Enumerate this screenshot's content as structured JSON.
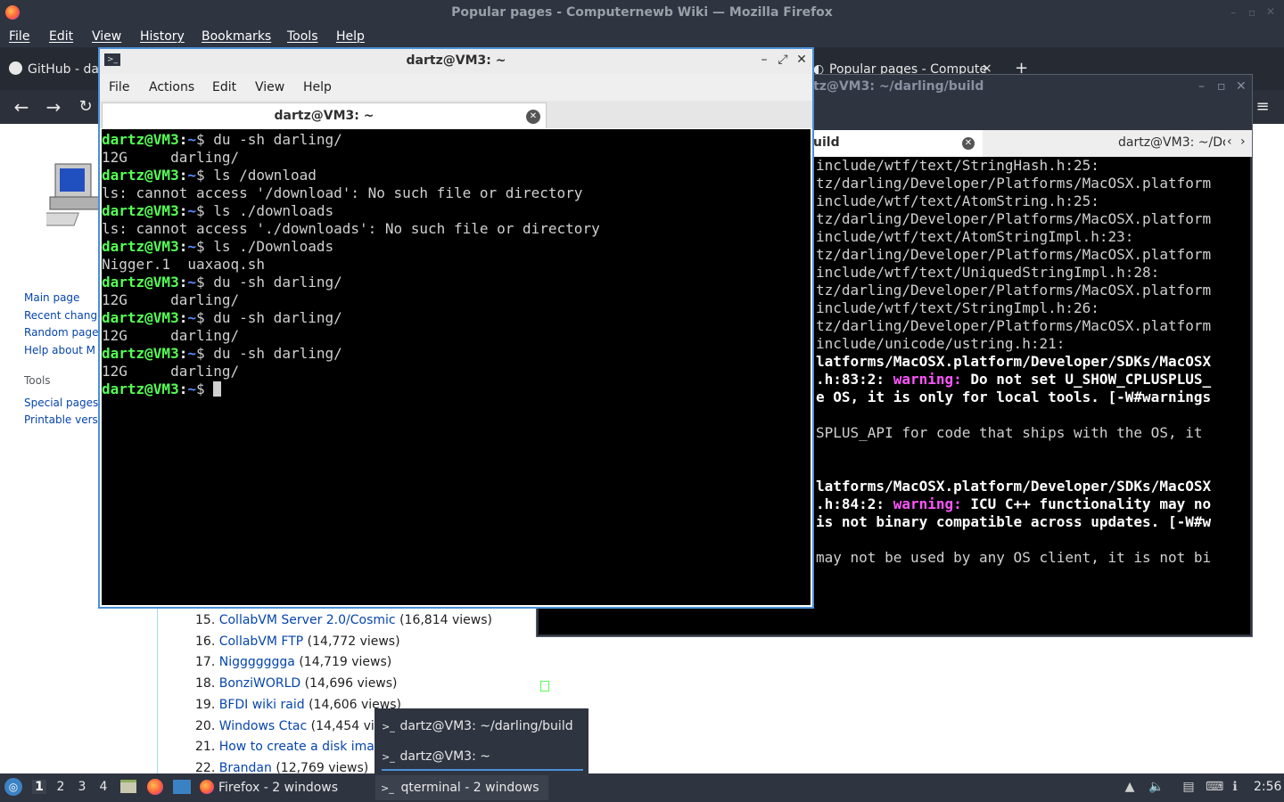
{
  "firefox": {
    "window_title": "Popular pages - Computernewb Wiki — Mozilla Firefox",
    "menu": [
      "File",
      "Edit",
      "View",
      "History",
      "Bookmarks",
      "Tools",
      "Help"
    ],
    "tabs": [
      {
        "label": "GitHub - dar",
        "icon": "github-icon"
      },
      {
        "label": "Popular pages - Compute",
        "icon": "wiki-icon"
      }
    ],
    "new_tab_label": "+"
  },
  "wiki": {
    "sidebar_nav": [
      "Main page",
      "Recent chang",
      "Random page",
      "Help about M"
    ],
    "tools_heading": "Tools",
    "tools": [
      "Special pages",
      "Printable vers"
    ],
    "ranks": [
      {
        "num": "15.",
        "title": "CollabVM Server 2.0/Cosmic",
        "views": "(16,814 views)"
      },
      {
        "num": "16.",
        "title": "CollabVM FTP",
        "views": "(14,772 views)"
      },
      {
        "num": "17.",
        "title": "Niggggggga",
        "views": "(14,719 views)"
      },
      {
        "num": "18.",
        "title": "BonziWORLD",
        "views": "(14,696 views)"
      },
      {
        "num": "19.",
        "title": "BFDI wiki raid",
        "views": "(14,606 views)"
      },
      {
        "num": "20.",
        "title": "Windows Ctac",
        "views": "(14,454 vi"
      },
      {
        "num": "21.",
        "title": "How to create a disk ima",
        "views": ""
      },
      {
        "num": "22.",
        "title": "Brandan",
        "views": "(12,769 views)"
      }
    ]
  },
  "term_back": {
    "title": "tz@VM3: ~/darling/build",
    "tab_active": "uild",
    "tab_other": "dartz@VM3: ~/Dc",
    "lines": [
      {
        "parts": [
          {
            "t": "include/wtf/text/StringHash.h:25:",
            "c": ""
          }
        ]
      },
      {
        "parts": [
          {
            "t": "tz/darling/Developer/Platforms/MacOSX.platform",
            "c": ""
          }
        ]
      },
      {
        "parts": [
          {
            "t": "include/wtf/text/AtomString.h:25:",
            "c": ""
          }
        ]
      },
      {
        "parts": [
          {
            "t": "tz/darling/Developer/Platforms/MacOSX.platform",
            "c": ""
          }
        ]
      },
      {
        "parts": [
          {
            "t": "include/wtf/text/AtomStringImpl.h:23:",
            "c": ""
          }
        ]
      },
      {
        "parts": [
          {
            "t": "tz/darling/Developer/Platforms/MacOSX.platform",
            "c": ""
          }
        ]
      },
      {
        "parts": [
          {
            "t": "include/wtf/text/UniquedStringImpl.h:28:",
            "c": ""
          }
        ]
      },
      {
        "parts": [
          {
            "t": "tz/darling/Developer/Platforms/MacOSX.platform",
            "c": ""
          }
        ]
      },
      {
        "parts": [
          {
            "t": "include/wtf/text/StringImpl.h:26:",
            "c": ""
          }
        ]
      },
      {
        "parts": [
          {
            "t": "tz/darling/Developer/Platforms/MacOSX.platform",
            "c": ""
          }
        ]
      },
      {
        "parts": [
          {
            "t": "include/unicode/ustring.h:21:",
            "c": ""
          }
        ]
      },
      {
        "parts": [
          {
            "t": "latforms/MacOSX.platform/Developer/SDKs/MacOSX",
            "c": "wb"
          }
        ]
      },
      {
        "parts": [
          {
            "t": ".h:83:2: ",
            "c": "wb"
          },
          {
            "t": "warning:",
            "c": "mg"
          },
          {
            "t": " Do not set U_SHOW_CPLUSPLUS_",
            "c": "wb"
          }
        ]
      },
      {
        "parts": [
          {
            "t": "e OS, it is only for local tools. [-W#warnings",
            "c": "wb"
          }
        ]
      },
      {
        "parts": [
          {
            "t": "",
            "c": ""
          }
        ]
      },
      {
        "parts": [
          {
            "t": "SPLUS_API for code that ships with the OS, it",
            "c": ""
          }
        ]
      },
      {
        "parts": [
          {
            "t": "",
            "c": ""
          }
        ]
      },
      {
        "parts": [
          {
            "t": "",
            "c": ""
          }
        ]
      },
      {
        "parts": [
          {
            "t": "latforms/MacOSX.platform/Developer/SDKs/MacOSX",
            "c": "wb"
          }
        ]
      },
      {
        "parts": [
          {
            "t": ".h:84:2: ",
            "c": "wb"
          },
          {
            "t": "warning:",
            "c": "mg"
          },
          {
            "t": " ICU C++ functionality may no",
            "c": "wb"
          }
        ]
      },
      {
        "parts": [
          {
            "t": "is not binary compatible across updates. [-W#w",
            "c": "wb"
          }
        ]
      },
      {
        "parts": [
          {
            "t": "",
            "c": ""
          }
        ]
      },
      {
        "parts": [
          {
            "t": "may not be used by any OS client, it is not bi",
            "c": ""
          }
        ]
      }
    ]
  },
  "term_front": {
    "title": "dartz@VM3: ~",
    "menu": [
      "File",
      "Actions",
      "Edit",
      "View",
      "Help"
    ],
    "tab_label": "dartz@VM3: ~",
    "lines": [
      {
        "parts": [
          {
            "t": "dartz@VM3",
            "c": "gr"
          },
          {
            "t": ":",
            "c": "wb"
          },
          {
            "t": "~",
            "c": "bl"
          },
          {
            "t": "$ du -sh darling/",
            "c": ""
          }
        ]
      },
      {
        "parts": [
          {
            "t": "12G     darling/",
            "c": ""
          }
        ]
      },
      {
        "parts": [
          {
            "t": "dartz@VM3",
            "c": "gr"
          },
          {
            "t": ":",
            "c": "wb"
          },
          {
            "t": "~",
            "c": "bl"
          },
          {
            "t": "$ ls /download",
            "c": ""
          }
        ]
      },
      {
        "parts": [
          {
            "t": "ls: cannot access '/download': No such file or directory",
            "c": ""
          }
        ]
      },
      {
        "parts": [
          {
            "t": "dartz@VM3",
            "c": "gr"
          },
          {
            "t": ":",
            "c": "wb"
          },
          {
            "t": "~",
            "c": "bl"
          },
          {
            "t": "$ ls ./downloads",
            "c": ""
          }
        ]
      },
      {
        "parts": [
          {
            "t": "ls: cannot access './downloads': No such file or directory",
            "c": ""
          }
        ]
      },
      {
        "parts": [
          {
            "t": "dartz@VM3",
            "c": "gr"
          },
          {
            "t": ":",
            "c": "wb"
          },
          {
            "t": "~",
            "c": "bl"
          },
          {
            "t": "$ ls ./Downloads",
            "c": ""
          }
        ]
      },
      {
        "parts": [
          {
            "t": "Nigger.1  uaxaoq.sh",
            "c": ""
          }
        ]
      },
      {
        "parts": [
          {
            "t": "dartz@VM3",
            "c": "gr"
          },
          {
            "t": ":",
            "c": "wb"
          },
          {
            "t": "~",
            "c": "bl"
          },
          {
            "t": "$ du -sh darling/",
            "c": ""
          }
        ]
      },
      {
        "parts": [
          {
            "t": "12G     darling/",
            "c": ""
          }
        ]
      },
      {
        "parts": [
          {
            "t": "dartz@VM3",
            "c": "gr"
          },
          {
            "t": ":",
            "c": "wb"
          },
          {
            "t": "~",
            "c": "bl"
          },
          {
            "t": "$ du -sh darling/",
            "c": ""
          }
        ]
      },
      {
        "parts": [
          {
            "t": "12G     darling/",
            "c": ""
          }
        ]
      },
      {
        "parts": [
          {
            "t": "dartz@VM3",
            "c": "gr"
          },
          {
            "t": ":",
            "c": "wb"
          },
          {
            "t": "~",
            "c": "bl"
          },
          {
            "t": "$ du -sh darling/",
            "c": ""
          }
        ]
      },
      {
        "parts": [
          {
            "t": "12G     darling/",
            "c": ""
          }
        ]
      },
      {
        "parts": [
          {
            "t": "dartz@VM3",
            "c": "gr"
          },
          {
            "t": ":",
            "c": "wb"
          },
          {
            "t": "~",
            "c": "bl"
          },
          {
            "t": "$ ",
            "c": ""
          }
        ]
      }
    ]
  },
  "popup": {
    "items": [
      "dartz@VM3: ~/darling/build",
      "dartz@VM3: ~"
    ]
  },
  "taskbar": {
    "desktops": [
      "1",
      "2",
      "3",
      "4"
    ],
    "firefox_task": "Firefox - 2 windows",
    "qterminal_task": "qterminal - 2 windows",
    "clock": "2:56"
  },
  "colors": {
    "accent": "#4a90d9",
    "prompt_green": "#55ff55",
    "prompt_blue": "#5c8cff",
    "warning_magenta": "#ff55ff",
    "link": "#0645ad"
  }
}
